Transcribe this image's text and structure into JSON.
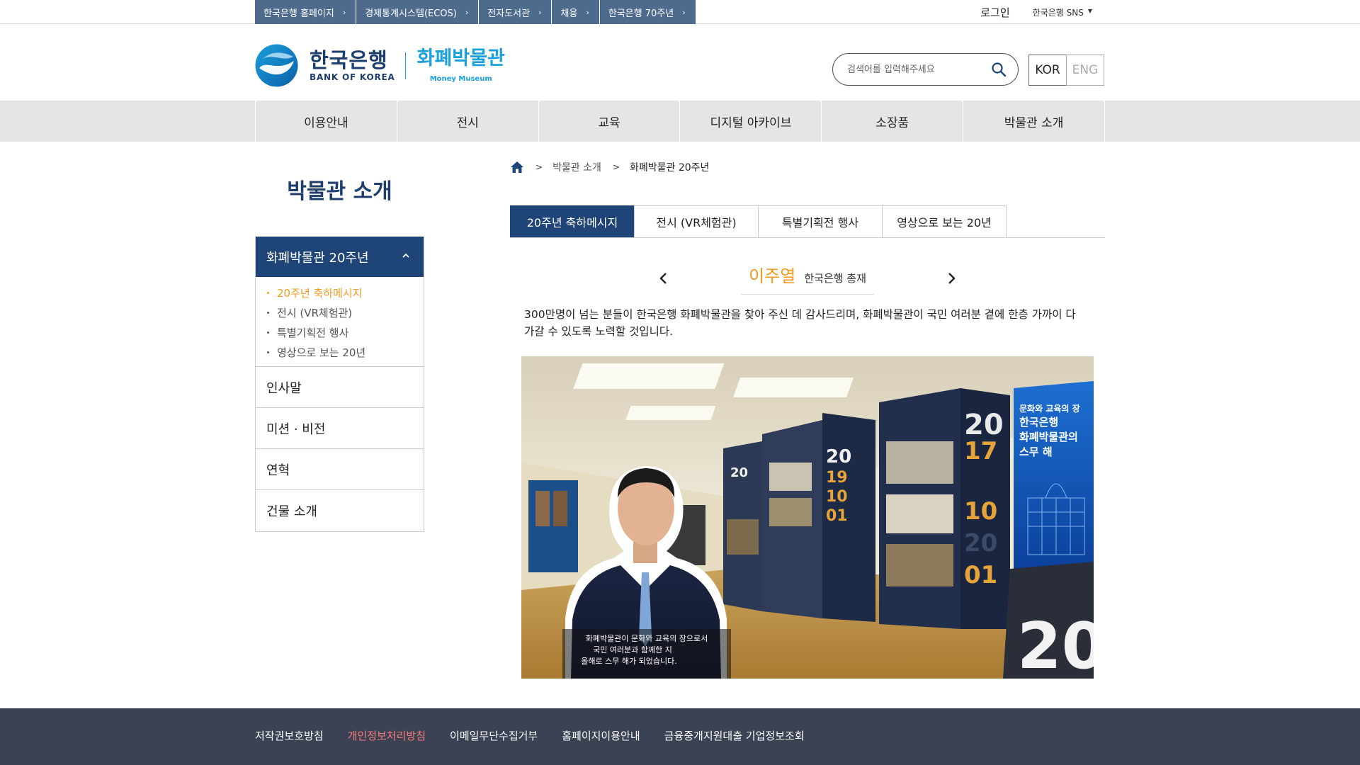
{
  "util_bar": {
    "links": [
      {
        "label": "한국은행 홈페이지"
      },
      {
        "label": "경제통계시스템(ECOS)"
      },
      {
        "label": "전자도서관"
      },
      {
        "label": "채용"
      },
      {
        "label": "한국은행 70주년"
      }
    ],
    "login": "로그인",
    "sns": "한국은행 SNS"
  },
  "header": {
    "logo_ko": "한국은행",
    "logo_en": "BANK OF KOREA",
    "museum_ko": "화폐박물관",
    "museum_en": "Money Museum",
    "search_placeholder": "검색어를 입력해주세요",
    "lang_kor": "KOR",
    "lang_eng": "ENG"
  },
  "gnb": [
    "이용안내",
    "전시",
    "교육",
    "디지털 아카이브",
    "소장품",
    "박물관 소개"
  ],
  "sidebar": {
    "title": "박물관 소개",
    "active": "화폐박물관 20주년",
    "sub_items": [
      "20주년 축하메시지",
      "전시 (VR체험관)",
      "특별기획전 행사",
      "영상으로 보는 20년"
    ],
    "items": [
      "인사말",
      "미션 · 비전",
      "연혁",
      "건물 소개"
    ]
  },
  "breadcrumb": {
    "level1": "박물관 소개",
    "level2": "화폐박물관 20주년"
  },
  "tabs": [
    "20주년 축하메시지",
    "전시 (VR체험관)",
    "특별기획전 행사",
    "영상으로 보는 20년"
  ],
  "speaker": {
    "name": "이주열",
    "title": "한국은행 총재"
  },
  "message": "300만명이 넘는 분들이 한국은행 화폐박물관을 찾아 주신 데 감사드리며, 화폐박물관이 국민 여러분 곁에 한층 가까이 다가갈 수 있도록 노력할 것입니다.",
  "photo": {
    "panel_title_1": "문화와 교육의 장",
    "panel_title_2": "한국은행",
    "panel_title_3": "화폐박물관의",
    "panel_title_4": "스무 해",
    "years_1": [
      "20",
      "19",
      "10",
      "01"
    ],
    "years_2": [
      "20",
      "17",
      "10",
      "20",
      "01"
    ],
    "small_year": "20",
    "big_number": "20",
    "caption_1": "화폐박물관이 문화와 교육의 장으로서",
    "caption_2": "국민 여러분과 함께한 지",
    "caption_3": "올해로 스무 해가 되었습니다."
  },
  "footer": [
    "저작권보호방침",
    "개인정보처리방침",
    "이메일무단수집거부",
    "홈페이지이용안내",
    "금융중개지원대출 기업정보조회"
  ],
  "colors": {
    "navy": "#1f4477",
    "accent_orange": "#f29a1e",
    "util_blue": "#4e6b8e",
    "museum_blue": "#1aa0dc",
    "footer_bg": "#3a4254",
    "footer_highlight": "#f87a7a"
  }
}
